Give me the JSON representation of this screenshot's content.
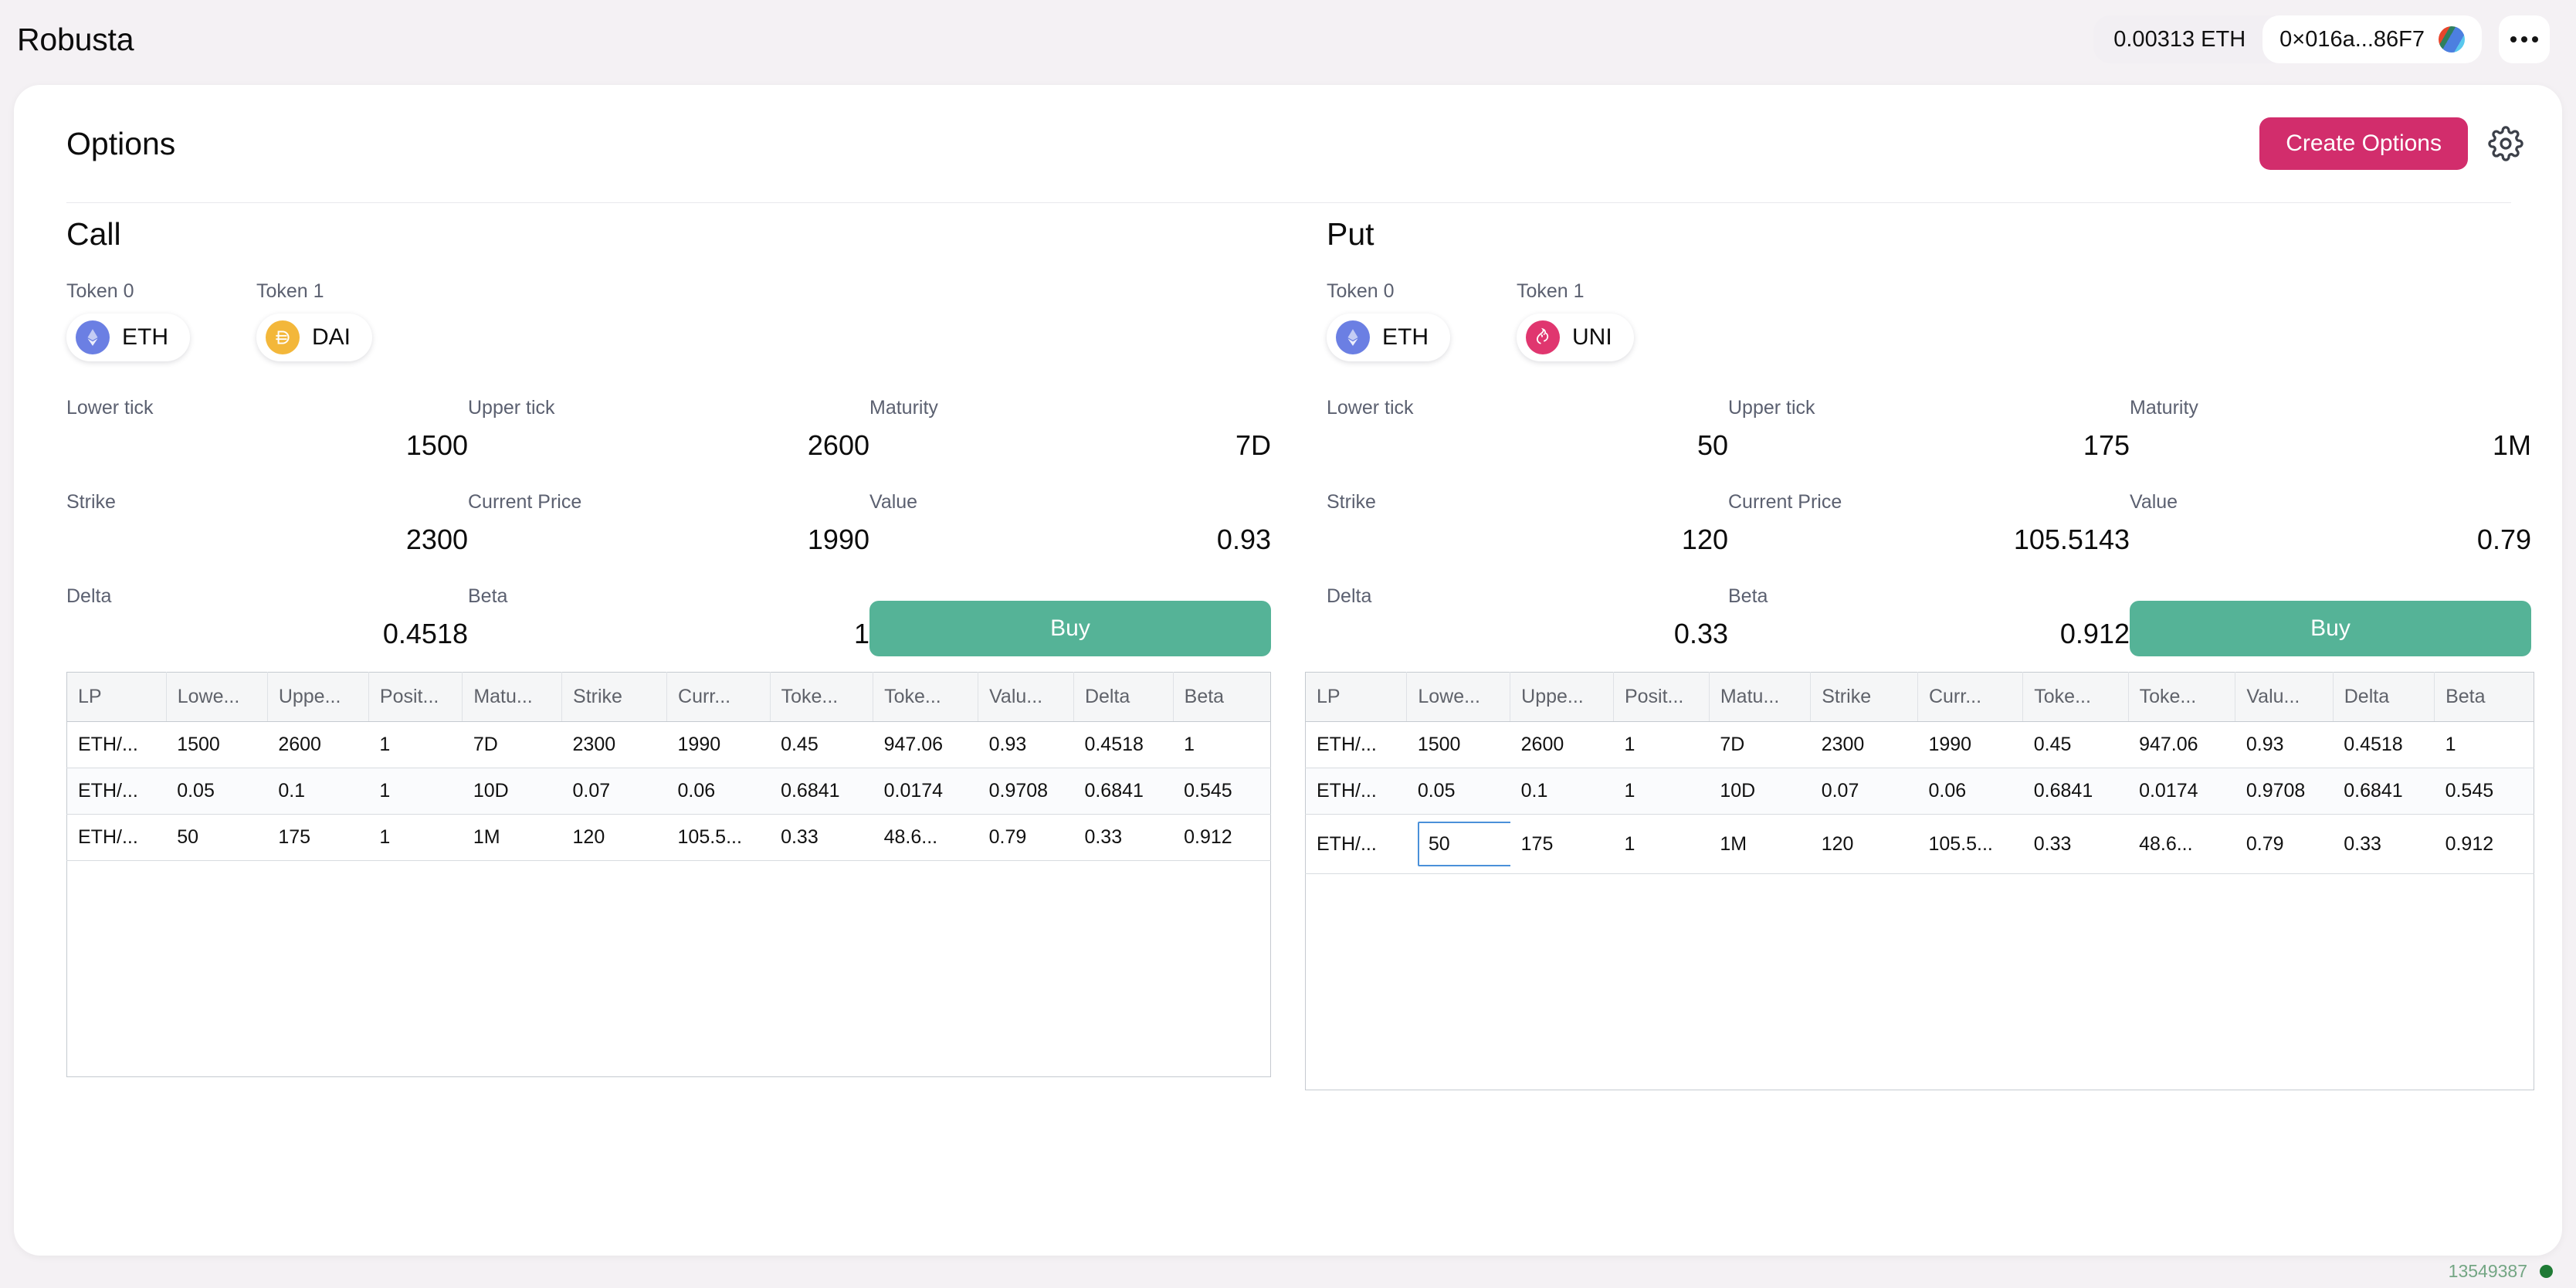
{
  "header": {
    "brand": "Robusta",
    "balance": "0.00313 ETH",
    "address": "0×016a...86F7",
    "avatar_icon": "account-avatar",
    "menu_icon": "kebab-menu-icon"
  },
  "card": {
    "title": "Options",
    "create_label": "Create Options",
    "settings_icon": "gear-icon",
    "accent_pink": "#D22D6C",
    "accent_green": "#55B397"
  },
  "call": {
    "title": "Call",
    "token0_label": "Token 0",
    "token1_label": "Token 1",
    "token0_symbol": "ETH",
    "token1_symbol": "DAI",
    "token0_icon": "eth-token-icon",
    "token1_icon": "dai-token-icon",
    "fields": {
      "lower_tick_label": "Lower tick",
      "lower_tick_value": "1500",
      "upper_tick_label": "Upper tick",
      "upper_tick_value": "2600",
      "maturity_label": "Maturity",
      "maturity_value": "7D",
      "strike_label": "Strike",
      "strike_value": "2300",
      "current_price_label": "Current Price",
      "current_price_value": "1990",
      "value_label": "Value",
      "value_value": "0.93",
      "delta_label": "Delta",
      "delta_value": "0.4518",
      "beta_label": "Beta",
      "beta_value": "1"
    },
    "buy_label": "Buy"
  },
  "put": {
    "title": "Put",
    "token0_label": "Token 0",
    "token1_label": "Token 1",
    "token0_symbol": "ETH",
    "token1_symbol": "UNI",
    "token0_icon": "eth-token-icon",
    "token1_icon": "uni-token-icon",
    "fields": {
      "lower_tick_label": "Lower tick",
      "lower_tick_value": "50",
      "upper_tick_label": "Upper tick",
      "upper_tick_value": "175",
      "maturity_label": "Maturity",
      "maturity_value": "1M",
      "strike_label": "Strike",
      "strike_value": "120",
      "current_price_label": "Current Price",
      "current_price_value": "105.5143",
      "value_label": "Value",
      "value_value": "0.79",
      "delta_label": "Delta",
      "delta_value": "0.33",
      "beta_label": "Beta",
      "beta_value": "0.912"
    },
    "buy_label": "Buy"
  },
  "table": {
    "columns": [
      "LP",
      "Lowe...",
      "Uppe...",
      "Posit...",
      "Matu...",
      "Strike",
      "Curr...",
      "Toke...",
      "Toke...",
      "Valu...",
      "Delta",
      "Beta"
    ],
    "rows": [
      [
        "ETH/...",
        "1500",
        "2600",
        "1",
        "7D",
        "2300",
        "1990",
        "0.45",
        "947.06",
        "0.93",
        "0.4518",
        "1"
      ],
      [
        "ETH/...",
        "0.05",
        "0.1",
        "1",
        "10D",
        "0.07",
        "0.06",
        "0.6841",
        "0.0174",
        "0.9708",
        "0.6841",
        "0.545"
      ],
      [
        "ETH/...",
        "50",
        "175",
        "1",
        "1M",
        "120",
        "105.5...",
        "0.33",
        "48.6...",
        "0.79",
        "0.33",
        "0.912"
      ]
    ],
    "editing_cell_value": "50"
  },
  "footer": {
    "block_number": "13549387",
    "status_icon": "connected-dot"
  }
}
